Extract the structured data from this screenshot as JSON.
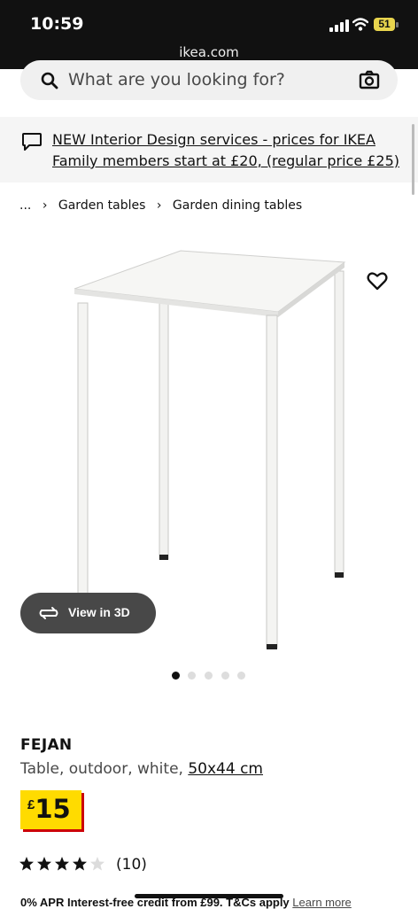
{
  "status_bar": {
    "time": "10:59",
    "url": "ikea.com",
    "battery": "51"
  },
  "search": {
    "placeholder": "What are you looking for?"
  },
  "banner": {
    "text": "NEW Interior Design services - prices for IKEA Family members start at £20, (regular price £25)"
  },
  "breadcrumb": {
    "ellipsis": "...",
    "items": [
      "Garden tables",
      "Garden dining tables"
    ]
  },
  "gallery": {
    "view_3d_label": "View in 3D",
    "image_count": 5,
    "active_index": 0
  },
  "product": {
    "name": "FEJAN",
    "description": "Table, outdoor, white,",
    "size": "50x44 cm",
    "currency": "£",
    "price": "15",
    "rating": 4,
    "rating_max": 5,
    "review_count": "(10)"
  },
  "credit": {
    "text": "0% APR Interest-free credit from £99. T&Cs apply",
    "link": "Learn more"
  },
  "colors": {
    "price_bg": "#ffdb00",
    "price_shadow": "#cc0008",
    "pill_bg": "#484848"
  }
}
